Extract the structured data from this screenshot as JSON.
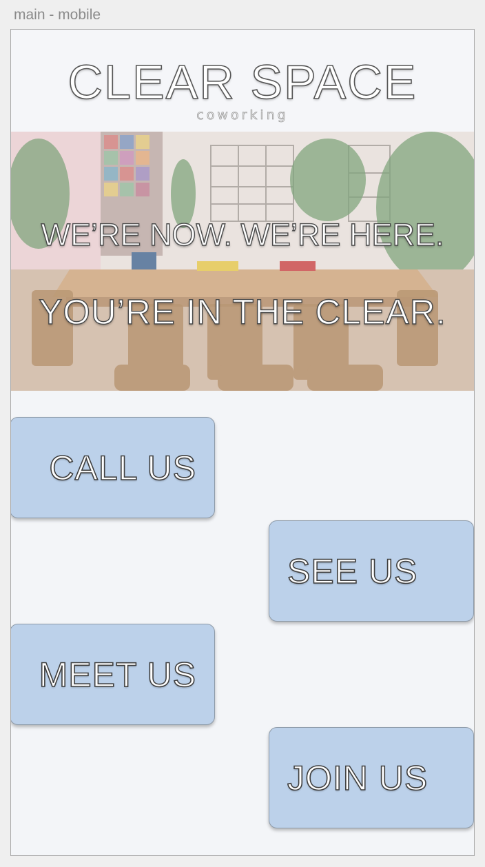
{
  "frame_label": "main - mobile",
  "header": {
    "brand": "CLEAR SPACE",
    "tagline": "coworking"
  },
  "hero": {
    "line1": "WE’RE NOW. WE’RE HERE.",
    "line2": "YOU’RE IN THE CLEAR."
  },
  "actions": {
    "call": "CALL US",
    "see": "SEE US",
    "meet": "MEET US",
    "join": "JOIN US"
  },
  "colors": {
    "background": "#f3f5f8",
    "button_fill": "#bcd1ea",
    "text_outline": "#3f3f3f"
  }
}
